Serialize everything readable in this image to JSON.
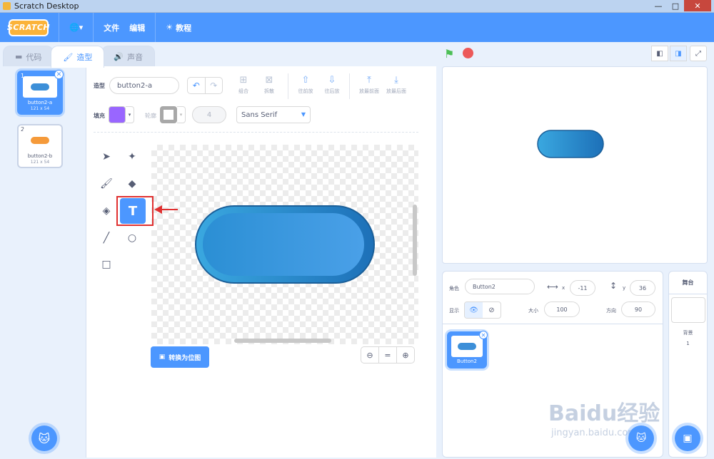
{
  "window": {
    "title": "Scratch Desktop",
    "minimize": "—",
    "maximize": "□",
    "close": "✕"
  },
  "menu": {
    "logo": "SCRATCH",
    "globe": "🌐▾",
    "file": "文件",
    "edit": "编辑",
    "tutorials": "教程"
  },
  "tabs": [
    {
      "label": "代码",
      "icon": "code-icon"
    },
    {
      "label": "造型",
      "icon": "brush-icon"
    },
    {
      "label": "声音",
      "icon": "speaker-icon"
    }
  ],
  "costumes": [
    {
      "num": "1",
      "name": "button2-a",
      "size": "121 x 54",
      "color": "#3d8fd8"
    },
    {
      "num": "2",
      "name": "button2-b",
      "size": "121 x 54",
      "color": "#f59a3a"
    }
  ],
  "paint": {
    "costume_label": "造型",
    "costume_name": "button2-a",
    "tools_top": [
      "组合",
      "拆散",
      "往前放",
      "往后放",
      "放最前面",
      "放最后面"
    ],
    "fill_label": "填充",
    "fill_color": "#9966ff",
    "outline_label": "轮廓",
    "outline_width": "4",
    "font": "Sans Serif",
    "convert_button": "转换为位图"
  },
  "sprite": {
    "sprite_label": "角色",
    "name": "Button2",
    "x_label": "x",
    "x": "-11",
    "y_label": "y",
    "y": "36",
    "show_label": "显示",
    "size_label": "大小",
    "size": "100",
    "direction_label": "方向",
    "direction": "90",
    "tile_name": "Button2"
  },
  "stage_panel": {
    "title": "舞台",
    "backdrops_label": "背景",
    "backdrops_count": "1"
  },
  "watermark": {
    "main": "Baidu经验",
    "sub": "jingyan.baidu.com"
  }
}
